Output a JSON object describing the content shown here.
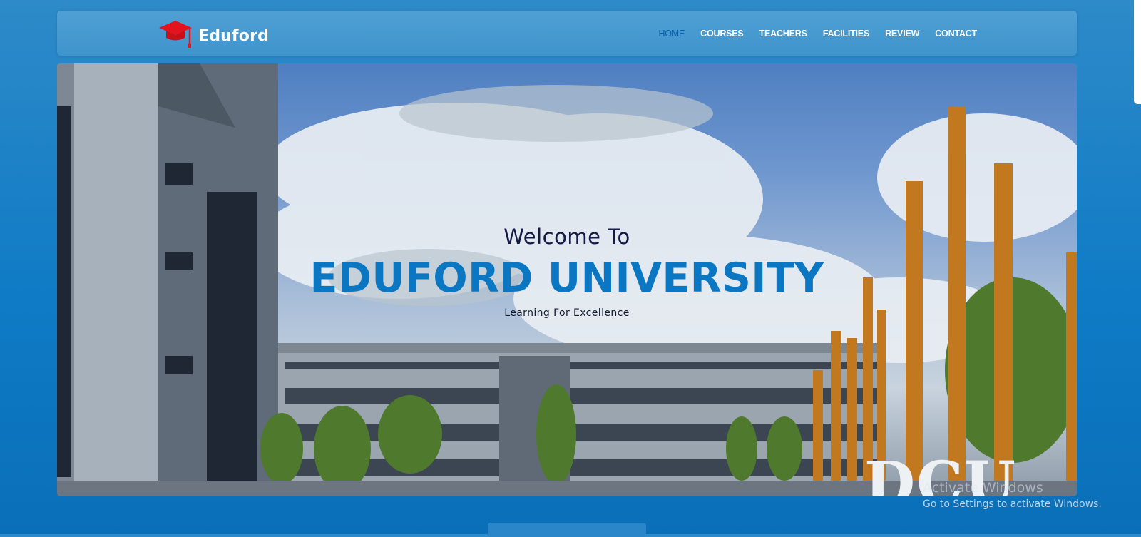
{
  "header": {
    "brand": "Eduford",
    "nav": [
      {
        "label": "HOME",
        "active": true
      },
      {
        "label": "COURSES",
        "active": false
      },
      {
        "label": "TEACHERS",
        "active": false
      },
      {
        "label": "FACILITIES",
        "active": false
      },
      {
        "label": "REVIEW",
        "active": false
      },
      {
        "label": "CONTACT",
        "active": false
      }
    ]
  },
  "hero": {
    "welcome": "Welcome To",
    "title": "EDUFORD UNIVERSITY",
    "tagline": "Learning For Excellence",
    "sign_text": "DCU"
  },
  "os_watermark": {
    "title": "Activate Windows",
    "subtitle": "Go to Settings to activate Windows."
  },
  "colors": {
    "page_bg": "#0f7bc6",
    "navbar_bg": "#4a9bd2",
    "accent": "#0b76c2",
    "logo": "#e3141e",
    "welcome_text": "#141a45"
  },
  "icons": {
    "logo": "graduation-cap-icon"
  }
}
